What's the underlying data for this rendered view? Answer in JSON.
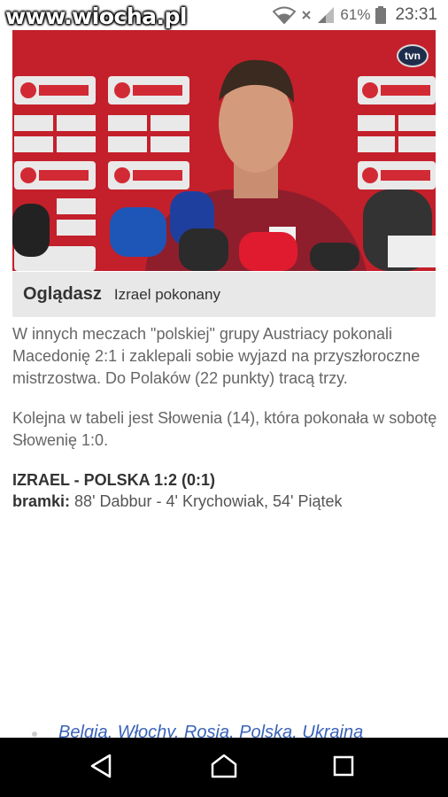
{
  "status_bar": {
    "watermark": "www.wiocha.pl",
    "battery_percent": "61%",
    "time": "23:31"
  },
  "video": {
    "channel_logo": "tvn"
  },
  "now_playing": {
    "label": "Oglądasz",
    "title": "Izrael pokonany"
  },
  "article": {
    "paragraph_1": "W innych meczach \"polskiej\" grupy Austriacy pokonali Macedonię 2:1 i zaklepali sobie wyjazd na przyszłoroczne mistrzostwa. Do Polaków (22 punkty) tracą trzy.",
    "paragraph_2": "Kolejna w tabeli jest Słowenia (14), która pokonała w sobotę Słowenię 1:0.",
    "match_title": "IZRAEL - POLSKA 1:2 (0:1)",
    "goals_label": "bramki:",
    "goals_text": "88' Dabbur - 4' Krychowiak, 54' Piątek",
    "related_link": "Belgia, Włochy, Rosja, Polska, Ukraina"
  },
  "nav": {
    "back": "back-icon",
    "home": "home-icon",
    "recents": "recents-icon"
  }
}
